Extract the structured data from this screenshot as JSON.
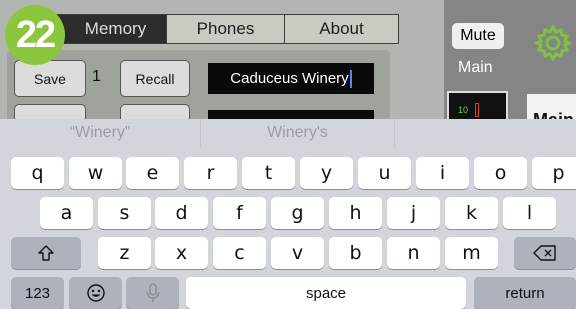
{
  "badge": {
    "number": "22"
  },
  "tabs": [
    {
      "label": "Memory",
      "selected": true
    },
    {
      "label": "Phones",
      "selected": false
    },
    {
      "label": "About",
      "selected": false
    }
  ],
  "memory": {
    "save_label": "Save",
    "slot_number": "1",
    "recall_label": "Recall",
    "name_value": "Caduceus Winery"
  },
  "right_panel": {
    "mute_label": "Mute",
    "main_label": "Main",
    "level_number": "10",
    "main_cut_text": "Main"
  },
  "suggestions": [
    "“Winery”",
    "Winery's",
    ""
  ],
  "keyboard": {
    "row1": [
      "q",
      "w",
      "e",
      "r",
      "t",
      "y",
      "u",
      "i",
      "o",
      "p"
    ],
    "row2": [
      "a",
      "s",
      "d",
      "f",
      "g",
      "h",
      "j",
      "k",
      "l"
    ],
    "row3": [
      "z",
      "x",
      "c",
      "v",
      "b",
      "n",
      "m"
    ],
    "numbers_label": "123",
    "space_label": "space",
    "return_label": "return"
  },
  "colors": {
    "badge": "#8cc63f",
    "gear": "#7dc242",
    "caret": "#4a8bf5",
    "keyboard_bg": "#d2d5db"
  },
  "icons": [
    "gear-icon",
    "shift-icon",
    "backspace-icon",
    "emoji-icon",
    "microphone-icon"
  ]
}
